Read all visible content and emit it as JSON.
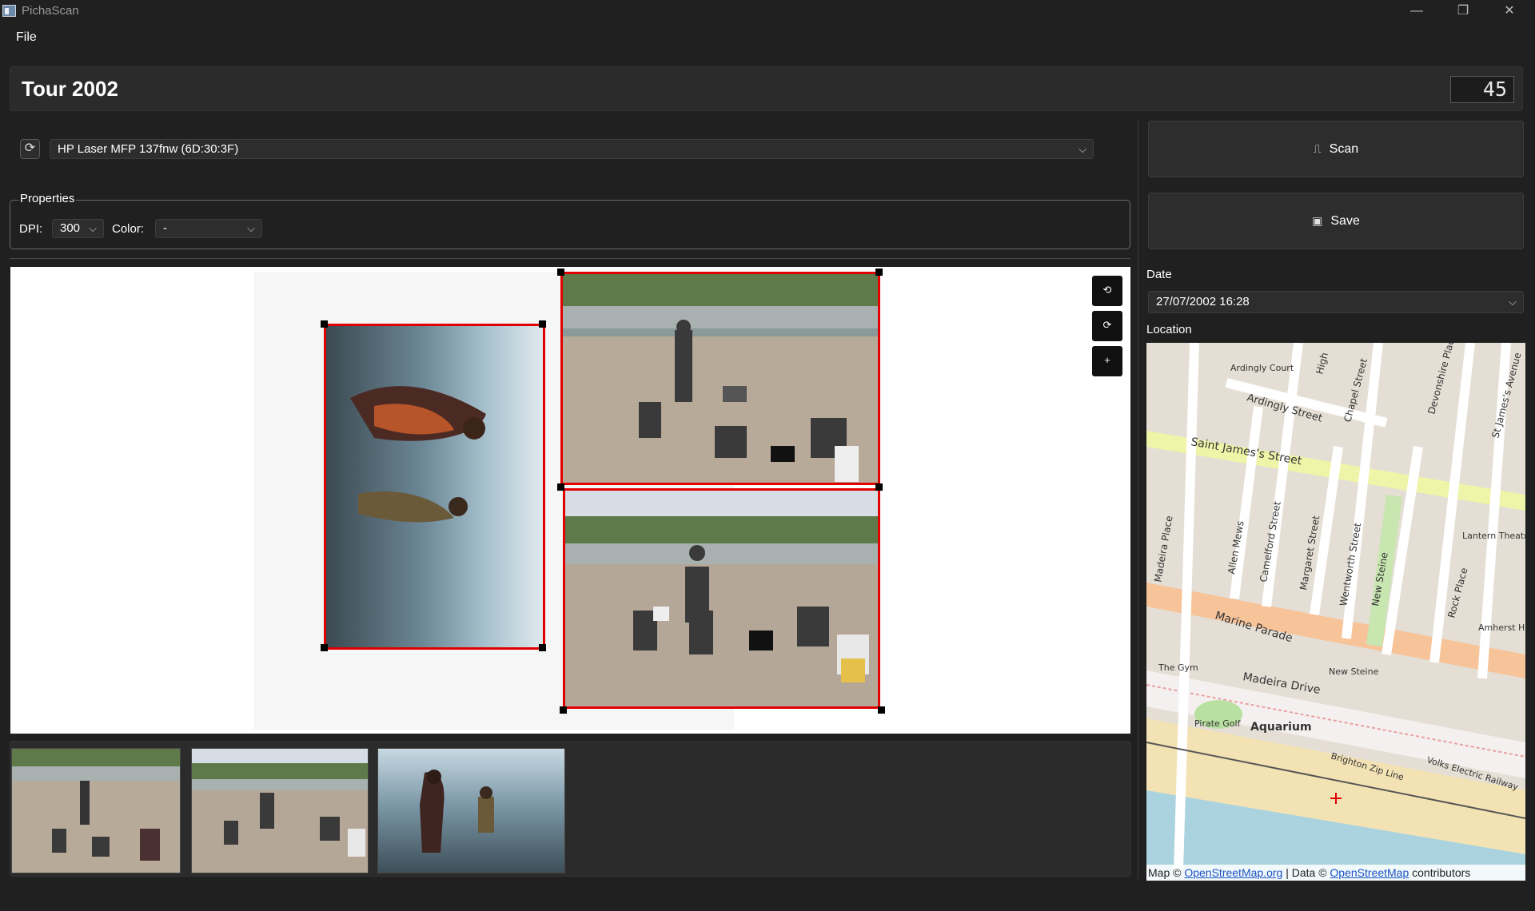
{
  "window": {
    "title": "PichaScan",
    "minimize_glyph": "—",
    "restore_glyph": "❐",
    "close_glyph": "✕"
  },
  "menu": {
    "file": "File"
  },
  "header": {
    "title": "Tour 2002",
    "counter": "45"
  },
  "scanner": {
    "refresh_icon": "refresh-icon",
    "selected": "HP Laser MFP 137fnw (6D:30:3F)"
  },
  "properties": {
    "legend": "Properties",
    "dpi_label": "DPI:",
    "dpi_value": "300",
    "color_label": "Color:",
    "color_value": "-"
  },
  "preview_tools": {
    "rotate_left": "⟲",
    "rotate_right": "⟳",
    "add": "+"
  },
  "actions": {
    "scan_label": "Scan",
    "scan_icon": "scanner-icon",
    "save_label": "Save",
    "save_icon": "save-icon"
  },
  "date": {
    "label": "Date",
    "value": "27/07/2002 16:28"
  },
  "location": {
    "label": "Location",
    "attribution": {
      "prefix": "Map © ",
      "link1": "OpenStreetMap.org",
      "middle": " | Data © ",
      "link2": "OpenStreetMap",
      "suffix": " contributors"
    },
    "streets": [
      "Ardingly Street",
      "Saint James's Street",
      "Madeira Place",
      "Marine Parade",
      "Madeira Drive",
      "Camelford Street",
      "Margaret Street",
      "Wentworth Street",
      "New Steine",
      "Rock Place",
      "Chapel Street",
      "Devonshire Place",
      "St James's Avenue",
      "Allen Mews",
      "Brighton Zip Line",
      "Volks Electric Railway",
      "High"
    ],
    "places": [
      "Aquarium",
      "Pirate Golf",
      "The Gym",
      "Lantern Theatre",
      "Amherst House",
      "Ardingly Court",
      "New Steine"
    ]
  },
  "colors": {
    "accent_red": "#e00000",
    "background": "#202020",
    "panel": "#2b2b2b"
  }
}
